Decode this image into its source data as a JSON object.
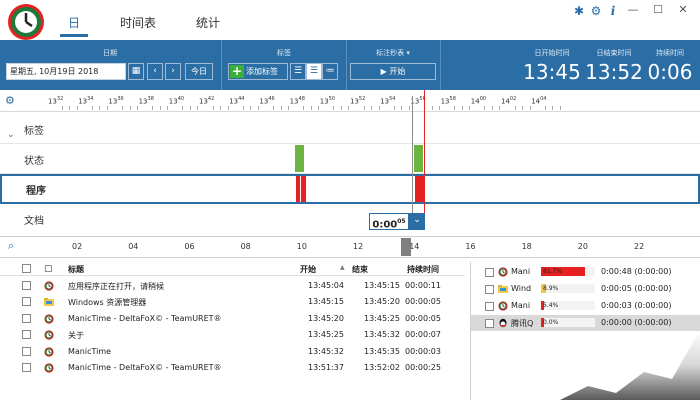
{
  "tabs": [
    {
      "label": "日",
      "active": true
    },
    {
      "label": "时间表",
      "active": false
    },
    {
      "label": "统计",
      "active": false
    }
  ],
  "header": {
    "date_section_label": "日期",
    "date_value": "星期五, 10月19日 2018",
    "today_label": "今日",
    "tags_section_label": "标签",
    "add_tag_label": "添加标签",
    "stopwatch_label": "标注秒表 ▾",
    "start_label": "开始",
    "day_start_label": "日开始时间",
    "day_start_value": "13:45",
    "day_end_label": "日结束时间",
    "day_end_value": "13:52",
    "duration_label": "持续时间",
    "duration_value": "0:06"
  },
  "ruler_ticks": [
    {
      "h": "13",
      "m": "32"
    },
    {
      "h": "13",
      "m": "34"
    },
    {
      "h": "13",
      "m": "36"
    },
    {
      "h": "13",
      "m": "38"
    },
    {
      "h": "13",
      "m": "40"
    },
    {
      "h": "13",
      "m": "42"
    },
    {
      "h": "13",
      "m": "44"
    },
    {
      "h": "13",
      "m": "46"
    },
    {
      "h": "13",
      "m": "48"
    },
    {
      "h": "13",
      "m": "50"
    },
    {
      "h": "13",
      "m": "52"
    },
    {
      "h": "13",
      "m": "54"
    },
    {
      "h": "13",
      "m": "56"
    },
    {
      "h": "13",
      "m": "58"
    },
    {
      "h": "14",
      "m": "00"
    },
    {
      "h": "14",
      "m": "02"
    },
    {
      "h": "14",
      "m": "04"
    }
  ],
  "rows": {
    "tags": "标签",
    "status": "状态",
    "apps": "程序",
    "docs": "文档"
  },
  "cursor_time": {
    "main": "0:00",
    "sec": "05"
  },
  "overview_ticks": [
    "02",
    "04",
    "06",
    "08",
    "10",
    "12",
    "14",
    "16",
    "18",
    "20",
    "22"
  ],
  "table": {
    "headers": {
      "label": "标题",
      "start": "开始",
      "end": "结束",
      "duration": "持续时间"
    },
    "sort_indicator": "▲",
    "rows": [
      {
        "title": "应用程序正在打开，请稍候",
        "start": "13:45:04",
        "end": "13:45:15",
        "duration": "00:00:11",
        "icon": "manictime-icon"
      },
      {
        "title": "Windows 资源管理器",
        "start": "13:45:15",
        "end": "13:45:20",
        "duration": "00:00:05",
        "icon": "explorer-icon"
      },
      {
        "title": "ManicTime - DeltaFoX© - TeamURET®",
        "start": "13:45:20",
        "end": "13:45:25",
        "duration": "00:00:05",
        "icon": "manictime-icon"
      },
      {
        "title": "关于",
        "start": "13:45:25",
        "end": "13:45:32",
        "duration": "00:00:07",
        "icon": "manictime-icon"
      },
      {
        "title": "ManicTime",
        "start": "13:45:32",
        "end": "13:45:35",
        "duration": "00:00:03",
        "icon": "manictime-icon"
      },
      {
        "title": "ManicTime - DeltaFoX© - TeamURET®",
        "start": "13:51:37",
        "end": "13:52:02",
        "duration": "00:00:25",
        "icon": "manictime-icon"
      }
    ]
  },
  "summary": [
    {
      "name": "Mani",
      "pct": "81.7%",
      "pct_value": 0.817,
      "color": "#e52121",
      "time": "0:00:48 (0:00:00)",
      "icon": "manictime-icon"
    },
    {
      "name": "Wind",
      "pct": "8.9%",
      "pct_value": 0.089,
      "color": "#f0c94a",
      "time": "0:00:05 (0:00:00)",
      "icon": "explorer-icon"
    },
    {
      "name": "Mani",
      "pct": "5.4%",
      "pct_value": 0.054,
      "color": "#e52121",
      "time": "0:00:03 (0:00:00)",
      "icon": "manictime-icon"
    },
    {
      "name": "腾讯Q",
      "pct": "0.0%",
      "pct_value": 0.0,
      "color": "#e52121",
      "time": "0:00:00 (0:00:00)",
      "icon": "qq-icon"
    }
  ],
  "colors": {
    "accent": "#2b6ea5",
    "status_green": "#6db33f",
    "app_red": "#e52121"
  }
}
